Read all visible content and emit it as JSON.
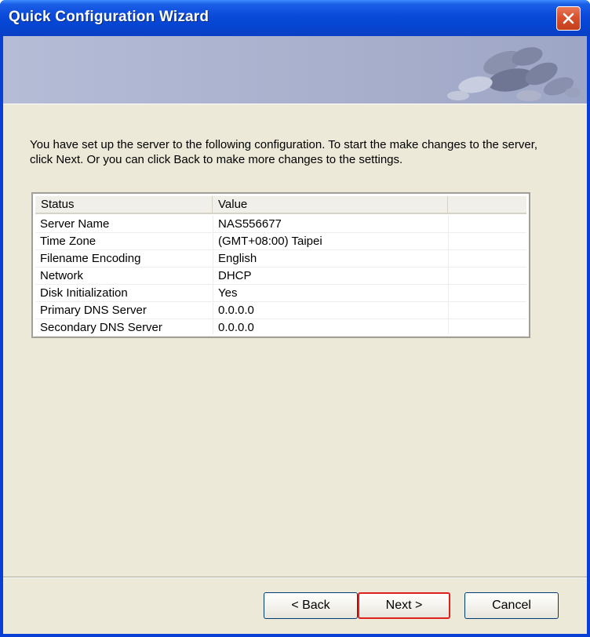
{
  "window": {
    "title": "Quick Configuration Wizard"
  },
  "description": "You have set up the server to the following configuration.  To start the make changes to the server, click Next. Or you can click Back to make more changes to the settings.",
  "table": {
    "columns": [
      "Status",
      "Value",
      ""
    ],
    "rows": [
      {
        "status": "Server Name",
        "value": "NAS556677"
      },
      {
        "status": "Time Zone",
        "value": "(GMT+08:00) Taipei"
      },
      {
        "status": "Filename Encoding",
        "value": "English"
      },
      {
        "status": "Network",
        "value": "DHCP"
      },
      {
        "status": "Disk Initialization",
        "value": "Yes"
      },
      {
        "status": "Primary DNS Server",
        "value": "0.0.0.0"
      },
      {
        "status": "Secondary DNS Server",
        "value": "0.0.0.0"
      }
    ]
  },
  "buttons": {
    "back": "< Back",
    "next": "Next >",
    "cancel": "Cancel"
  },
  "icons": {
    "close": "close-icon",
    "banner": "bubbles-graphic"
  },
  "colors": {
    "titlebar": "#0a49d9",
    "client": "#ece9d8",
    "banner": "#a7afcc",
    "highlight": "#e0201c"
  }
}
